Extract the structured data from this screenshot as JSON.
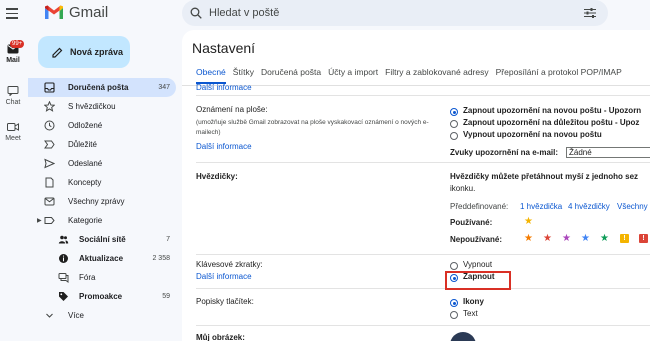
{
  "app": {
    "name": "Gmail"
  },
  "search": {
    "placeholder": "Hledat v poště"
  },
  "rail": {
    "badge": "99+",
    "items": [
      {
        "label": "Mail"
      },
      {
        "label": "Chat"
      },
      {
        "label": "Meet"
      }
    ]
  },
  "compose": {
    "label": "Nová zpráva"
  },
  "nav": {
    "items": [
      {
        "label": "Doručená pošta",
        "count": "347",
        "icon": "inbox-icon"
      },
      {
        "label": "S hvězdičkou",
        "count": "",
        "icon": "star-icon"
      },
      {
        "label": "Odložené",
        "count": "",
        "icon": "clock-icon"
      },
      {
        "label": "Důležité",
        "count": "",
        "icon": "important-icon"
      },
      {
        "label": "Odeslané",
        "count": "",
        "icon": "send-icon"
      },
      {
        "label": "Koncepty",
        "count": "",
        "icon": "draft-icon"
      },
      {
        "label": "Všechny zprávy",
        "count": "",
        "icon": "mail-icon"
      },
      {
        "label": "Kategorie",
        "count": "",
        "icon": "label-icon"
      },
      {
        "label": "Sociální sítě",
        "count": "7",
        "icon": "people-icon"
      },
      {
        "label": "Aktualizace",
        "count": "2 358",
        "icon": "info-icon"
      },
      {
        "label": "Fóra",
        "count": "",
        "icon": "forum-icon"
      },
      {
        "label": "Promoakce",
        "count": "59",
        "icon": "tag-icon"
      },
      {
        "label": "Více",
        "count": "",
        "icon": "chevron-down-icon"
      }
    ]
  },
  "settings": {
    "title": "Nastavení",
    "tabs": [
      "Obecné",
      "Štítky",
      "Doručená pošta",
      "Účty a import",
      "Filtry a zablokované adresy",
      "Přeposílání a protokol POP/IMAP"
    ],
    "top_link": "Další informace",
    "desktop": {
      "label": "Oznámení na ploše:",
      "desc": "(umožňuje službě Gmail zobrazovat na ploše vyskakovací oznámení o nových e-mailech)",
      "link": "Další informace",
      "options": [
        "Zapnout upozornění na novou poštu - Upozorn",
        "Zapnout upozornění na důležitou poštu - Upoz",
        "Vypnout upozornění na novou poštu"
      ],
      "sound_label": "Zvuky upozornění na e-mail:",
      "sound_value": "Žádné"
    },
    "stars": {
      "label": "Hvězdičky:",
      "desc_line1": "Hvězdičky můžete přetáhnout myší z jednoho sez",
      "desc_line2": "ikonku.",
      "predefined_label": "Předdefinované:",
      "predefined_1": "1 hvězdička",
      "predefined_4": "4 hvězdičky",
      "predefined_all": "Všechny",
      "used_label": "Používané:",
      "unused_label": "Nepoužívané:",
      "colors": {
        "yellow": "#f4b400",
        "orange": "#f57c00",
        "red": "#db4437",
        "purple": "#ab47bc",
        "blue": "#4285f4",
        "green": "#0f9d58"
      }
    },
    "shortcuts": {
      "label": "Klávesové zkratky:",
      "link": "Další informace",
      "options": [
        "Vypnout",
        "Zapnout"
      ]
    },
    "button_labels": {
      "label": "Popisky tlačítek:",
      "options": [
        "Ikony",
        "Text"
      ]
    },
    "picture": {
      "label": "Můj obrázek:"
    }
  }
}
